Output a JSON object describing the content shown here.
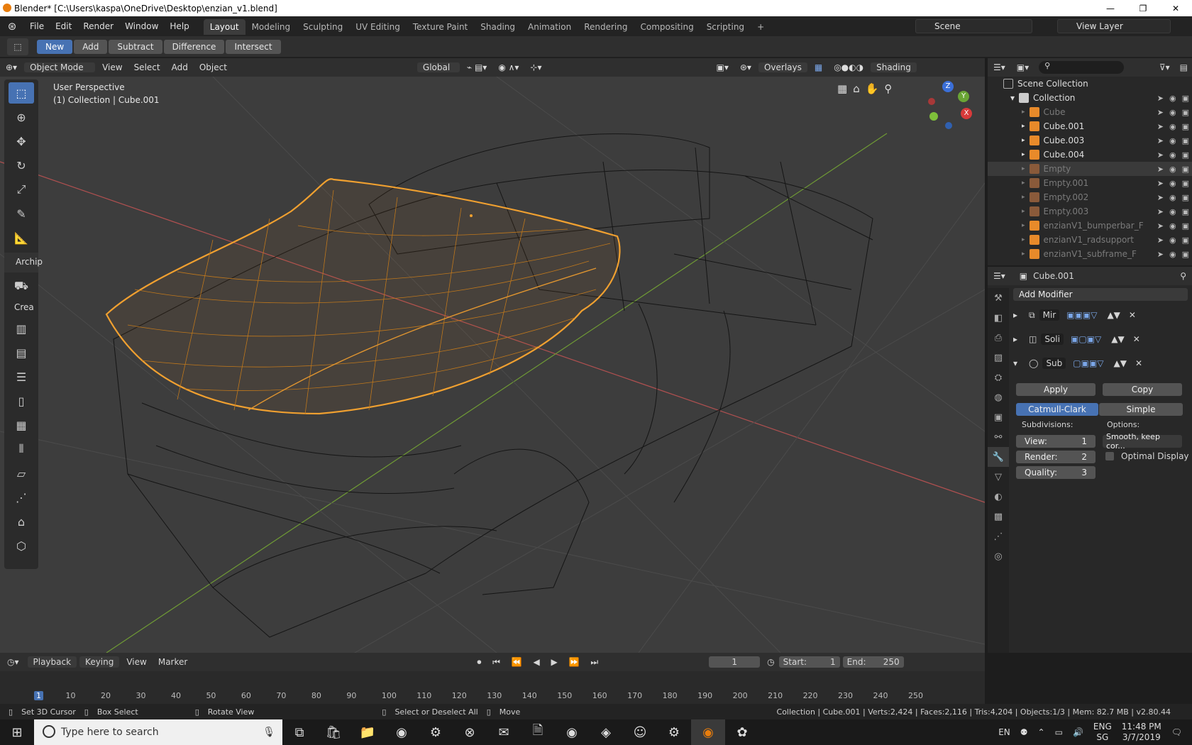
{
  "window": {
    "title": "Blender* [C:\\Users\\kaspa\\OneDrive\\Desktop\\enzian_v1.blend]",
    "minimize": "—",
    "maximize": "❐",
    "close": "✕"
  },
  "menu": [
    "File",
    "Edit",
    "Render",
    "Window",
    "Help"
  ],
  "workspaces": [
    "Layout",
    "Modeling",
    "Sculpting",
    "UV Editing",
    "Texture Paint",
    "Shading",
    "Animation",
    "Rendering",
    "Compositing",
    "Scripting",
    "+"
  ],
  "scene": {
    "name": "Scene",
    "view_layer": "View Layer"
  },
  "tool_settings": {
    "new": "New",
    "add": "Add",
    "subtract": "Subtract",
    "difference": "Difference",
    "intersect": "Intersect"
  },
  "viewport_header": {
    "mode": "Object Mode",
    "view": "View",
    "select": "Select",
    "add": "Add",
    "object": "Object",
    "orientation": "Global",
    "overlays": "Overlays",
    "shading": "Shading"
  },
  "viewport": {
    "perspective": "User Perspective",
    "collection_info": "(1) Collection | Cube.001",
    "toolbar_section": "Archip",
    "toolbar_create": "Crea"
  },
  "gizmo": {
    "z": "Z",
    "y": "Y",
    "x": "X"
  },
  "outliner": {
    "scene_collection": "Scene Collection",
    "collection": "Collection",
    "items": [
      {
        "name": "Cube",
        "dim": true,
        "sel": false
      },
      {
        "name": "Cube.001",
        "dim": false,
        "sel": false
      },
      {
        "name": "Cube.003",
        "dim": false,
        "sel": false
      },
      {
        "name": "Cube.004",
        "dim": false,
        "sel": false
      },
      {
        "name": "Empty",
        "dim": true,
        "sel": true
      },
      {
        "name": "Empty.001",
        "dim": true,
        "sel": false
      },
      {
        "name": "Empty.002",
        "dim": true,
        "sel": false
      },
      {
        "name": "Empty.003",
        "dim": true,
        "sel": false
      },
      {
        "name": "enzianV1_bumperbar_F",
        "dim": true,
        "sel": false
      },
      {
        "name": "enzianV1_radsupport",
        "dim": true,
        "sel": false
      },
      {
        "name": "enzianV1_subframe_F",
        "dim": true,
        "sel": false
      }
    ]
  },
  "properties": {
    "object_name": "Cube.001",
    "add_modifier": "Add Modifier",
    "modifiers": [
      "Mir",
      "Soli",
      "Sub"
    ],
    "apply": "Apply",
    "copy": "Copy",
    "catmull": "Catmull-Clark",
    "simple": "Simple",
    "subdivisions": "Subdivisions:",
    "options": "Options:",
    "view_label": "View:",
    "view_val": "1",
    "render_label": "Render:",
    "render_val": "2",
    "quality_label": "Quality:",
    "quality_val": "3",
    "uv_smooth": "Smooth, keep cor...",
    "optimal": "Optimal Display"
  },
  "timeline": {
    "playback": "Playback",
    "keying": "Keying",
    "view": "View",
    "marker": "Marker",
    "current_frame": "1",
    "start_label": "Start:",
    "start": "1",
    "end_label": "End:",
    "end": "250",
    "ticks": [
      "1",
      "10",
      "20",
      "30",
      "40",
      "50",
      "60",
      "70",
      "80",
      "90",
      "100",
      "110",
      "120",
      "130",
      "140",
      "150",
      "160",
      "170",
      "180",
      "190",
      "200",
      "210",
      "220",
      "230",
      "240",
      "250"
    ]
  },
  "status": {
    "cursor": "Set 3D Cursor",
    "box": "Box Select",
    "rotate": "Rotate View",
    "select": "Select or Deselect All",
    "move": "Move",
    "stats": "Collection | Cube.001 | Verts:2,424 | Faces:2,116 | Tris:4,204 | Objects:1/3 | Mem: 82.7 MB | v2.80.44"
  },
  "taskbar": {
    "search": "Type here to search",
    "lang": "EN",
    "lang2": "ENG",
    "region": "SG",
    "time": "11:48 PM",
    "date": "3/7/2019"
  }
}
